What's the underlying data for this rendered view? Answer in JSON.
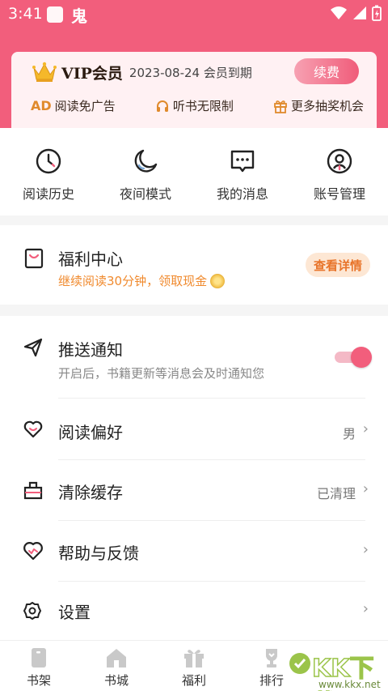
{
  "status_bar": {
    "time": "3:41",
    "app_glyph": "鬼"
  },
  "vip": {
    "title": "VIP会员",
    "expiry": "2023-08-24 会员到期",
    "renew_label": "续费",
    "perks": [
      {
        "badge": "AD",
        "label": "阅读免广告"
      },
      {
        "label": "听书无限制"
      },
      {
        "label": "更多抽奖机会"
      }
    ]
  },
  "quick_actions": [
    {
      "label": "阅读历史",
      "icon": "clock-icon"
    },
    {
      "label": "夜间模式",
      "icon": "moon-icon"
    },
    {
      "label": "我的消息",
      "icon": "message-icon"
    },
    {
      "label": "账号管理",
      "icon": "account-icon"
    }
  ],
  "welfare": {
    "title": "福利中心",
    "subtitle": "继续阅读30分钟，领取现金",
    "button": "查看详情"
  },
  "settings": {
    "push": {
      "title": "推送通知",
      "subtitle": "开启后，书籍更新等消息会及时通知您",
      "enabled": true
    },
    "preference": {
      "title": "阅读偏好",
      "value": "男"
    },
    "cache": {
      "title": "清除缓存",
      "value": "已清理"
    },
    "help": {
      "title": "帮助与反馈"
    },
    "settings": {
      "title": "设置"
    }
  },
  "tabs": [
    {
      "label": "书架",
      "icon": "bookshelf-icon"
    },
    {
      "label": "书城",
      "icon": "store-icon"
    },
    {
      "label": "福利",
      "icon": "gift-icon"
    },
    {
      "label": "排行",
      "icon": "trophy-icon"
    }
  ],
  "watermark": {
    "text": "KK下载",
    "url": "www.kkx.net"
  },
  "colors": {
    "brand": "#f25e7c",
    "accent_orange": "#f08a2e"
  }
}
